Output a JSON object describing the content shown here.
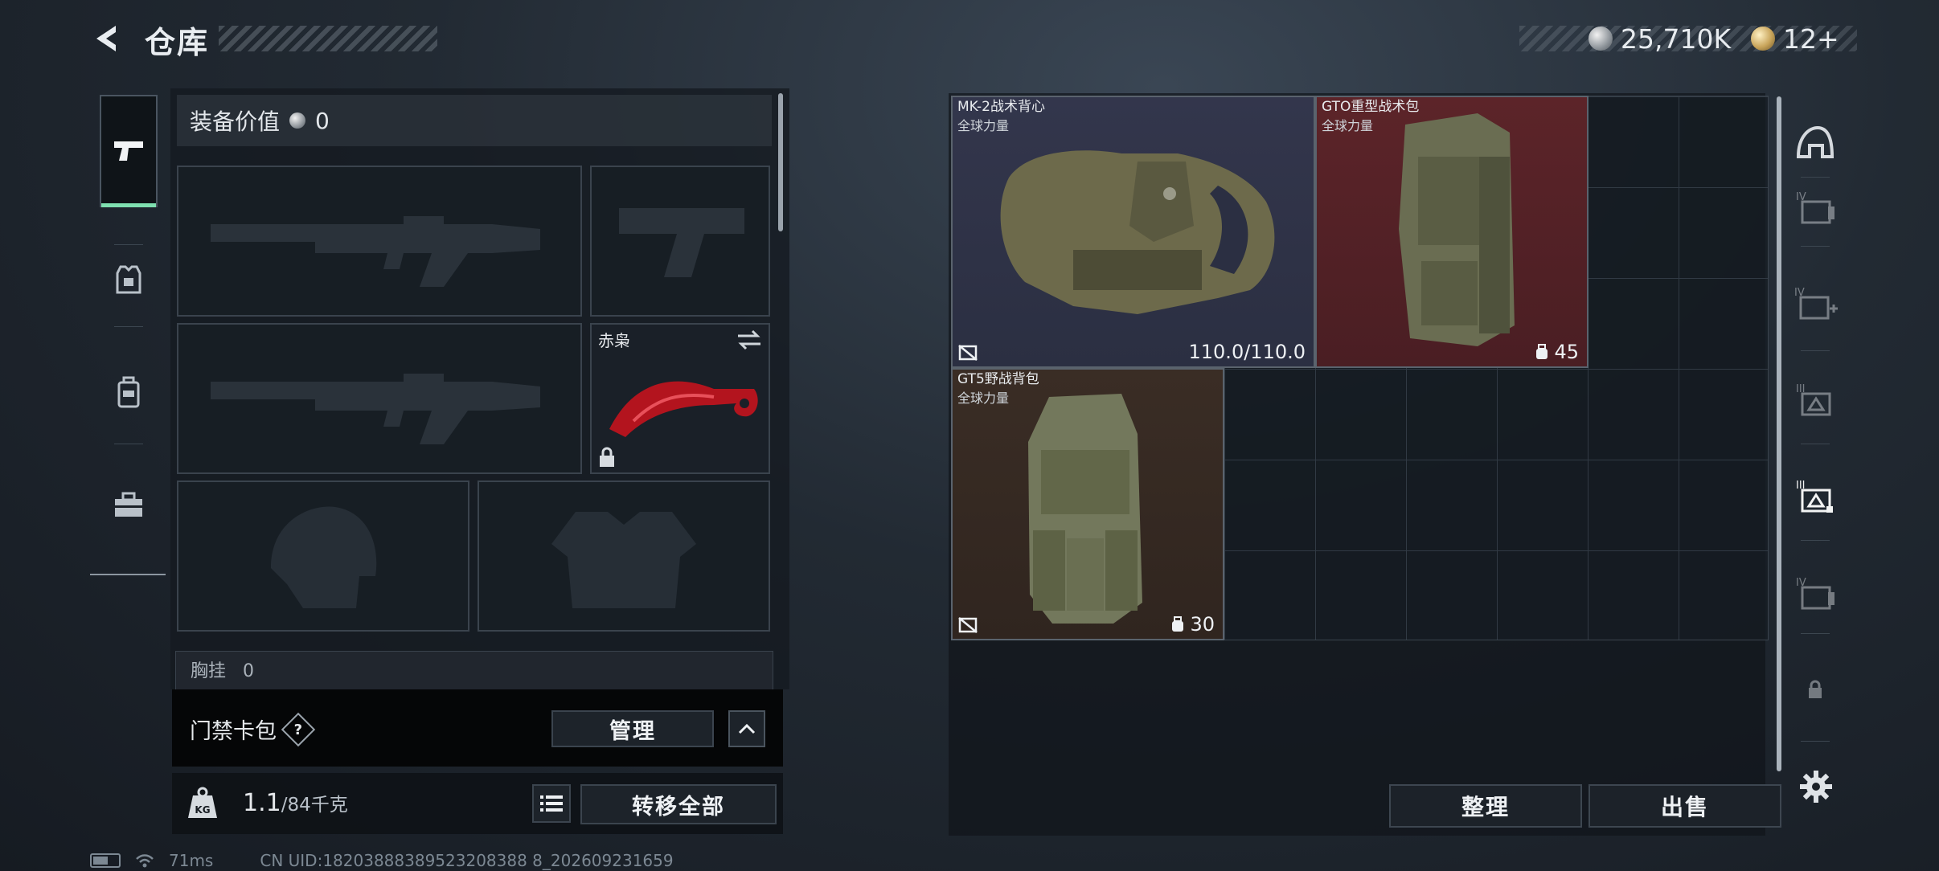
{
  "header": {
    "title": "仓库",
    "currency_silver": "25,710K",
    "currency_gold": "12+"
  },
  "left_rail": {
    "items": [
      {
        "name": "weapons",
        "icon": "pistol-icon",
        "active": true
      },
      {
        "name": "armor",
        "icon": "armor-icon",
        "active": false
      },
      {
        "name": "backpack",
        "icon": "backpack-icon",
        "active": false
      },
      {
        "name": "toolbox",
        "icon": "toolbox-icon",
        "active": false
      }
    ]
  },
  "loadout": {
    "equip_value_label": "装备价值",
    "equip_value": "0",
    "knife_slot": {
      "name": "赤枭",
      "icon": "karambit-icon"
    },
    "chest_rig_label": "胸挂",
    "chest_rig_value": "0"
  },
  "card_pack": {
    "label": "门禁卡包",
    "help": "?",
    "manage_label": "管理"
  },
  "weight": {
    "current": "1.1",
    "max": "/84千克",
    "transfer_all_label": "转移全部"
  },
  "stash_items": [
    {
      "name": "MK-2战术背心",
      "rarity": "全球力量",
      "stat": "110.0/110.0",
      "color": "#33364c"
    },
    {
      "name": "GTO重型战术包",
      "rarity": "全球力量",
      "stat": "45",
      "color": "#5c2429"
    },
    {
      "name": "GT5野战背包",
      "rarity": "全球力量",
      "stat": "30",
      "color": "#3a2d25"
    }
  ],
  "actions": {
    "sort_label": "整理",
    "sell_label": "出售"
  },
  "right_rail": {
    "items": [
      {
        "name": "helmet-filter",
        "icon": "helmet-icon"
      },
      {
        "name": "tier-iv-a",
        "icon": "tier-iv-case-icon",
        "label": "IV"
      },
      {
        "name": "tier-iv-med",
        "icon": "tier-iv-med-icon",
        "label": "IV"
      },
      {
        "name": "tier-iii",
        "icon": "tier-iii-case-icon",
        "label": "III"
      },
      {
        "name": "tier-iii-active",
        "icon": "tier-iii-active-icon",
        "label": "III"
      },
      {
        "name": "tier-iv-b",
        "icon": "tier-iv-case-icon",
        "label": "IV"
      },
      {
        "name": "locked",
        "icon": "lock-icon"
      }
    ]
  },
  "footer": {
    "ping": "71ms",
    "uid": "CN UID:18203888389523208388 8_202609231659"
  }
}
